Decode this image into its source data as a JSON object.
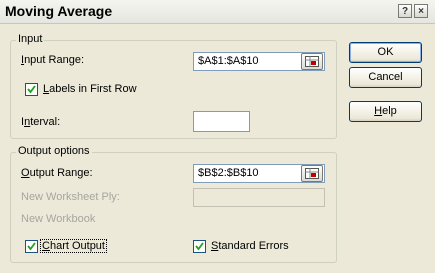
{
  "window": {
    "title": "Moving Average",
    "help_glyph": "?",
    "close_glyph": "×"
  },
  "input_group": {
    "legend": "Input",
    "input_range_label_u": "I",
    "input_range_label_rest": "nput Range:",
    "input_range_value": "$A$1:$A$10",
    "labels_first_row_label_u": "L",
    "labels_first_row_label_rest": "abels in First Row",
    "labels_first_row_checked": true,
    "interval_label_pre": "I",
    "interval_label_u": "n",
    "interval_label_rest": "terval:",
    "interval_value": ""
  },
  "output_group": {
    "legend": "Output options",
    "output_range_label_u": "O",
    "output_range_label_rest": "utput Range:",
    "output_range_value": "$B$2:$B$10",
    "new_worksheet_label": "New Worksheet Ply:",
    "new_worksheet_value": "",
    "new_workbook_label": "New Workbook",
    "chart_output_label_u": "C",
    "chart_output_label_rest": "hart Output",
    "chart_output_checked": true,
    "standard_errors_label_u": "S",
    "standard_errors_label_rest": "tandard Errors",
    "standard_errors_checked": true
  },
  "buttons": {
    "ok": "OK",
    "cancel": "Cancel",
    "help_u": "H",
    "help_rest": "elp"
  }
}
